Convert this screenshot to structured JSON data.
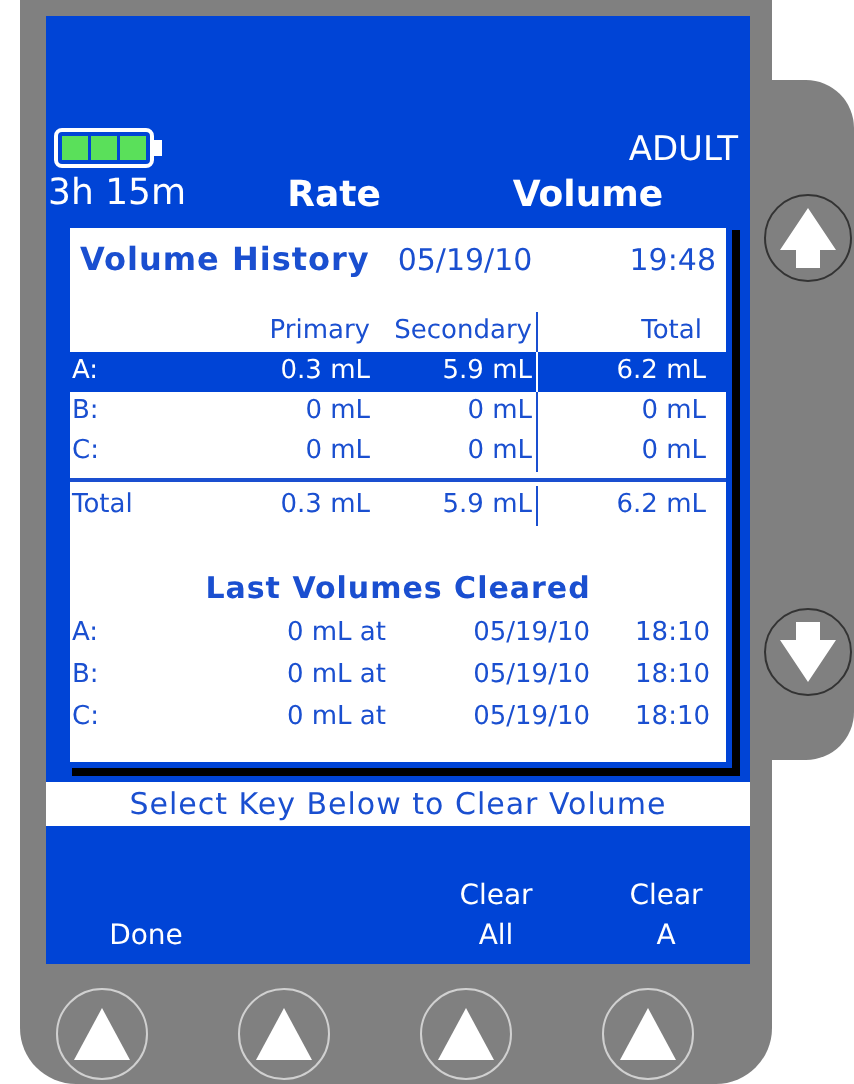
{
  "header": {
    "profile": "ADULT",
    "time_remaining": "3h 15m",
    "columns": [
      {
        "title": "Rate"
      },
      {
        "title": "Volume"
      }
    ]
  },
  "dialog": {
    "title": "Volume History",
    "date": "05/19/10",
    "time": "19:48",
    "columns": [
      "Primary",
      "Secondary",
      "Total"
    ],
    "rows": [
      {
        "label": "A:",
        "primary": "0.3 mL",
        "secondary": "5.9 mL",
        "total": "6.2 mL",
        "selected": true
      },
      {
        "label": "B:",
        "primary": "0 mL",
        "secondary": "0 mL",
        "total": "0 mL",
        "selected": false
      },
      {
        "label": "C:",
        "primary": "0 mL",
        "secondary": "0 mL",
        "total": "0 mL",
        "selected": false
      }
    ],
    "total_row": {
      "label": "Total",
      "primary": "0.3 mL",
      "secondary": "5.9 mL",
      "total": "6.2 mL"
    },
    "cleared": {
      "title": "Last Volumes Cleared",
      "rows": [
        {
          "label": "A:",
          "amount": "0 mL at",
          "date": "05/19/10",
          "time": "18:10"
        },
        {
          "label": "B:",
          "amount": "0 mL at",
          "date": "05/19/10",
          "time": "18:10"
        },
        {
          "label": "C:",
          "amount": "0 mL at",
          "date": "05/19/10",
          "time": "18:10"
        }
      ]
    }
  },
  "prompt": "Select Key Below to Clear Volume",
  "softkeys": [
    {
      "kind": "label",
      "lines": [
        "Done"
      ]
    },
    {
      "kind": "blank"
    },
    {
      "kind": "label",
      "lines": [
        "Clear",
        "All"
      ]
    },
    {
      "kind": "label",
      "lines": [
        "Clear",
        "A"
      ]
    }
  ]
}
